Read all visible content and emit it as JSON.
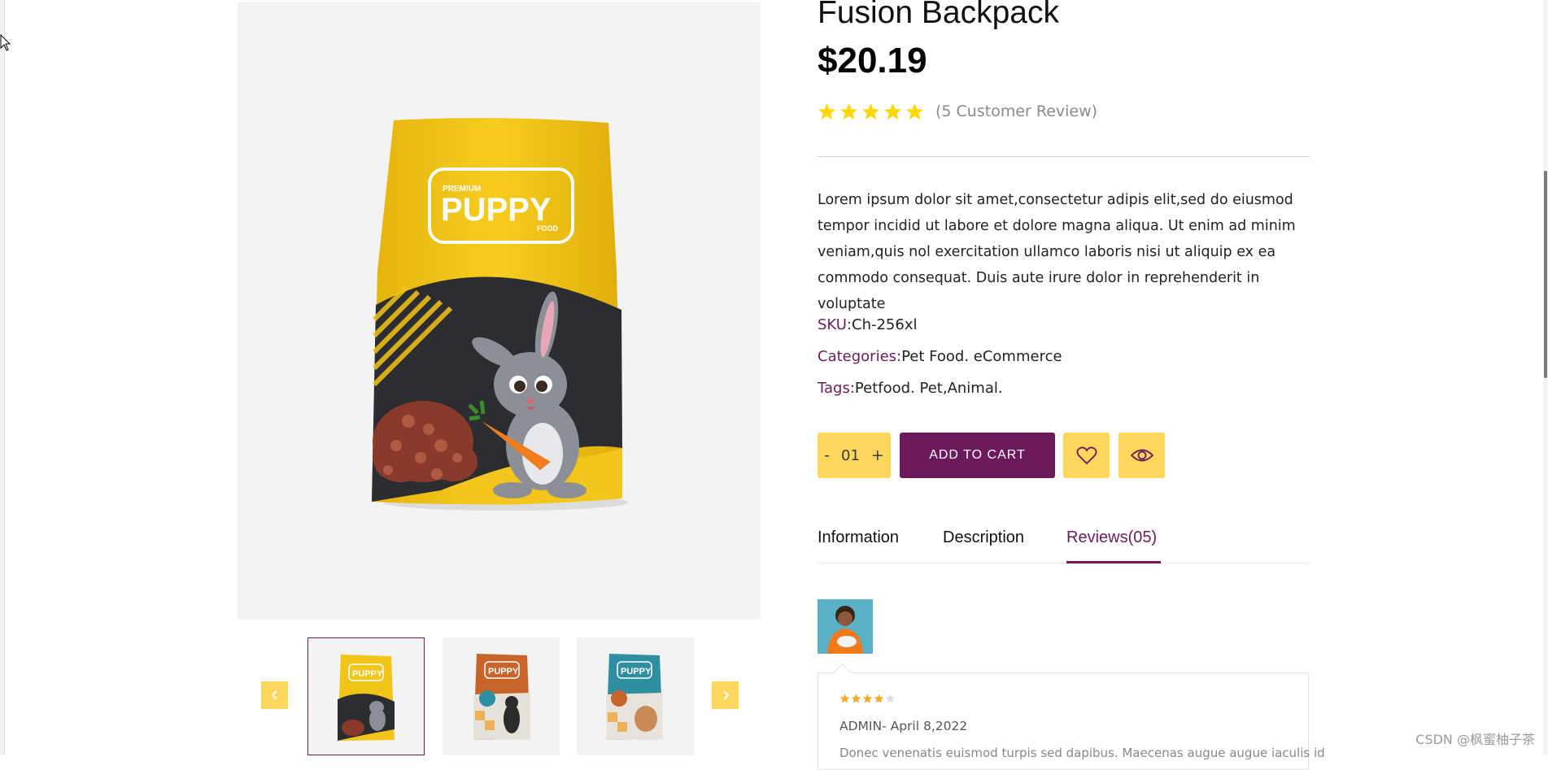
{
  "product": {
    "title": "Fusion Backpack",
    "price": "$20.19",
    "rating": {
      "stars": 5,
      "max": 5,
      "review_count_text": "(5 Customer Review)"
    },
    "description": "Lorem ipsum dolor sit amet,consectetur adipis elit,sed do eiusmod tempor incidid ut labore et dolore magna aliqua. Ut enim ad minim veniam,quis nol exercitation ullamco laboris nisi ut aliquip ex ea commodo consequat. Duis aute irure dolor in reprehenderit in voluptate",
    "sku": {
      "label": "SKU:",
      "value": "Ch-256xl"
    },
    "categories": {
      "label": "Categories:",
      "value": "Pet Food. eCommerce"
    },
    "tags": {
      "label": "Tags:",
      "value": "Petfood. Pet,Animal."
    }
  },
  "gallery": {
    "main_image_text": {
      "premium": "PREMIUM",
      "brand": "PUPPY",
      "food": "FOOD"
    },
    "thumbnails": [
      {
        "brand": "PUPPY",
        "color": "#f2c417",
        "active": true
      },
      {
        "brand": "PUPPY",
        "color": "#c8642a",
        "active": false
      },
      {
        "brand": "PUPPY",
        "color": "#2e8fa1",
        "active": false
      }
    ],
    "prev_icon": "chevron-left-icon",
    "next_icon": "chevron-right-icon"
  },
  "cart": {
    "minus": "-",
    "quantity": "01",
    "plus": "+",
    "add_to_cart": "ADD TO CART",
    "wishlist_icon": "heart-icon",
    "quickview_icon": "eye-icon"
  },
  "tabs": [
    {
      "label": "Information",
      "active": false
    },
    {
      "label": "Description",
      "active": false
    },
    {
      "label": "Reviews(05)",
      "active": true
    }
  ],
  "review": {
    "stars": 4,
    "max": 5,
    "author": "ADMIN-",
    "date": "April 8,2022",
    "text": "Donec venenatis euismod turpis sed dapibus. Maecenas augue augue iaculis id"
  },
  "watermark": "CSDN @枫蜜柚子茶",
  "colors": {
    "accent": "#6d1a5d",
    "yellow": "#fdd65c",
    "star": "#ffd700",
    "review_star": "#f5a623"
  }
}
